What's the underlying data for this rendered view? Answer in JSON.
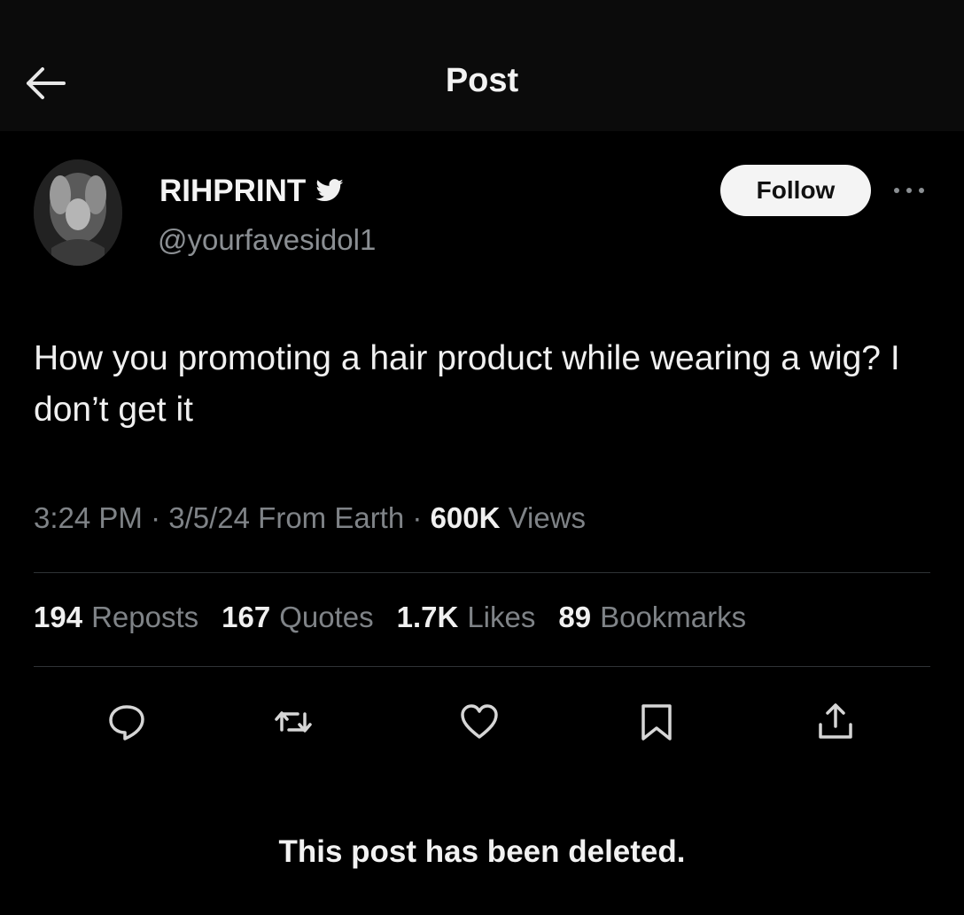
{
  "header": {
    "title": "Post",
    "back_icon": "arrow-left-icon"
  },
  "author": {
    "display_name": "RIHPRINT",
    "handle": "@yourfavesidol1",
    "badge_icon": "bird-icon"
  },
  "follow_label": "Follow",
  "post": {
    "text": "How you promoting a hair product while wearing a wig? I don’t get it"
  },
  "meta": {
    "time": "3:24 PM",
    "date": "3/5/24",
    "source": "From Earth",
    "views_count": "600K",
    "views_label": "Views",
    "separator": "·"
  },
  "stats": [
    {
      "count": "194",
      "label": "Reposts"
    },
    {
      "count": "167",
      "label": "Quotes"
    },
    {
      "count": "1.7K",
      "label": "Likes"
    },
    {
      "count": "89",
      "label": "Bookmarks"
    }
  ],
  "actions": [
    "reply-icon",
    "repost-icon",
    "like-icon",
    "bookmark-icon",
    "share-icon"
  ],
  "deleted_notice": "This post has been deleted."
}
